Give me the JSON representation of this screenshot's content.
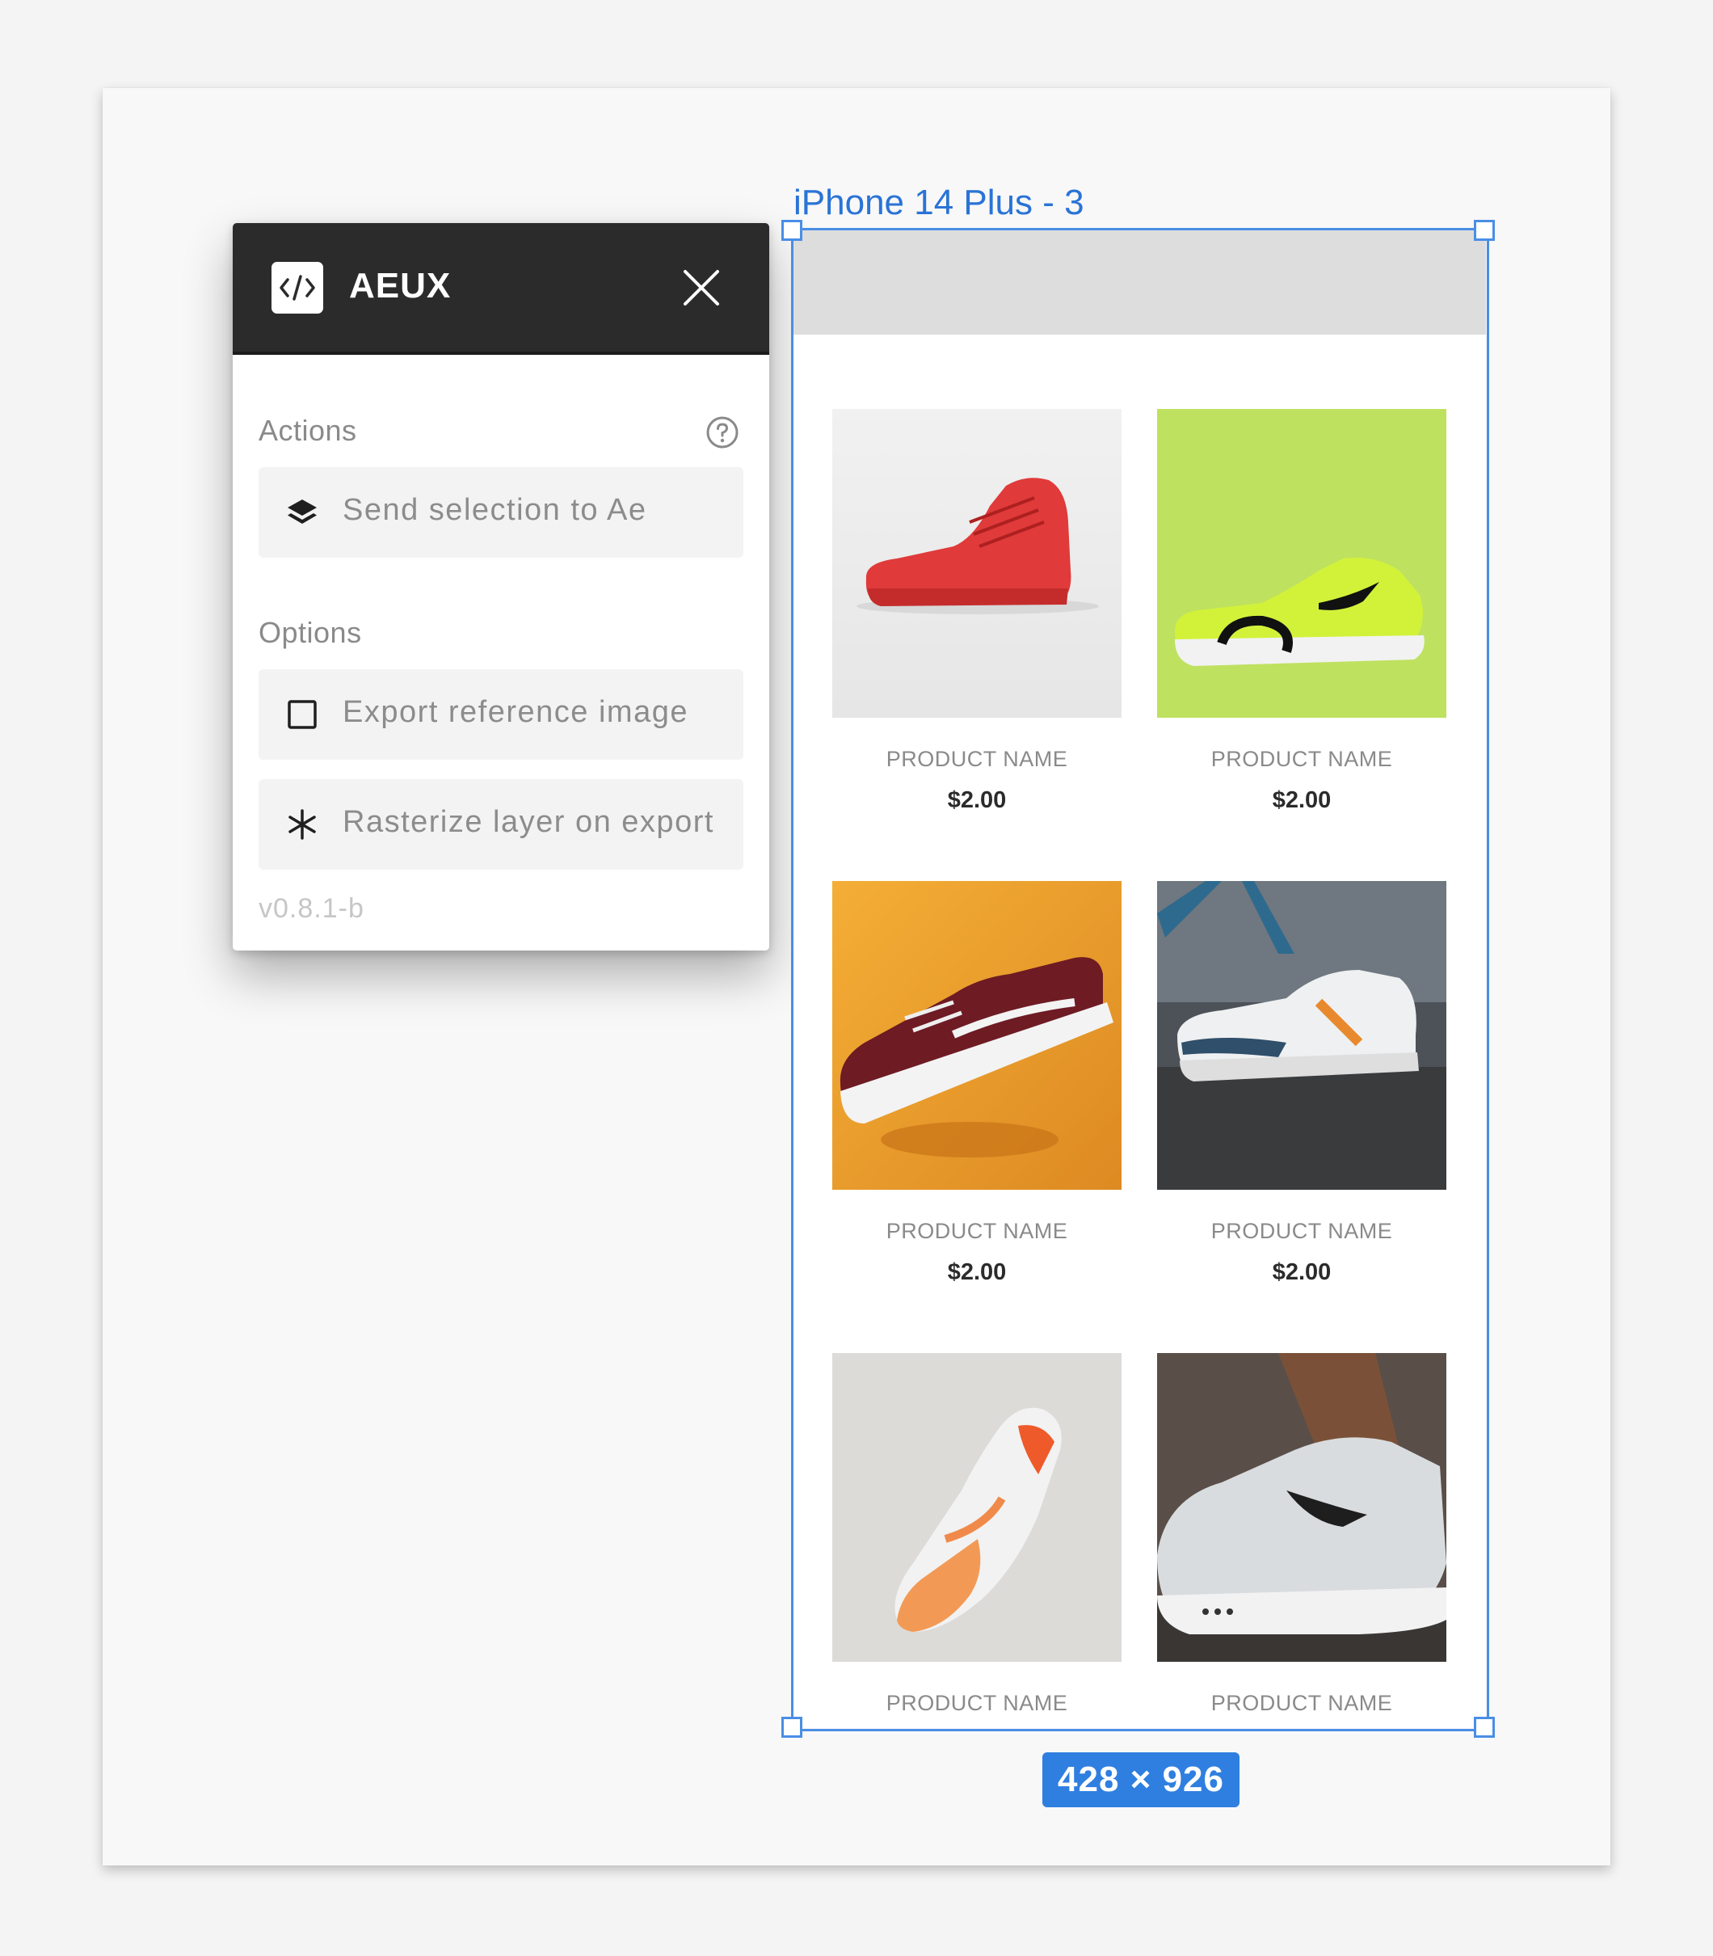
{
  "plugin": {
    "title": "AEUX",
    "logo_icon": "code-brackets-icon",
    "actions_label": "Actions",
    "send_selection_label": "Send selection to Ae",
    "options_label": "Options",
    "export_reference_label": "Export reference image",
    "export_reference_checked": false,
    "rasterize_label": "Rasterize layer on export",
    "version": "v0.8.1-b"
  },
  "artboard": {
    "name": "iPhone 14 Plus - 3",
    "dimensions": "428 × 926"
  },
  "products": [
    {
      "name": "PRODUCT NAME",
      "price": "$2.00",
      "image": "red-high-top-sneaker"
    },
    {
      "name": "PRODUCT NAME",
      "price": "$2.00",
      "image": "neon-green-nike-runner"
    },
    {
      "name": "PRODUCT NAME",
      "price": "$2.00",
      "image": "burgundy-vans-on-orange"
    },
    {
      "name": "PRODUCT NAME",
      "price": "$2.00",
      "image": "white-blue-orange-chunky-sneaker"
    },
    {
      "name": "PRODUCT NAME",
      "image": "white-orange-air-max"
    },
    {
      "name": "PRODUCT NAME",
      "image": "grey-nike-sb-on-foot"
    }
  ],
  "colors": {
    "selection": "#4a8ee6",
    "panel_header": "#2b2b2b",
    "badge": "#2f7fe0"
  }
}
